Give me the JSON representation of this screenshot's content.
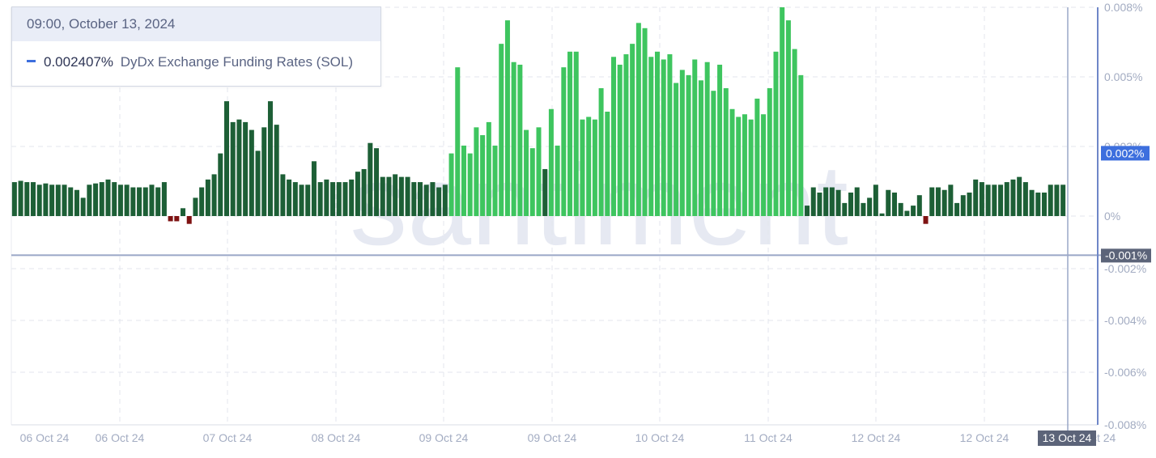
{
  "tooltip": {
    "datetime": "09:00, October 13, 2024",
    "value": "0.002407%",
    "series_name": "DyDx Exchange Funding Rates (SOL)"
  },
  "watermark": "santiment",
  "colors": {
    "dark_green": "#1d5f36",
    "light_green": "#3ec55f",
    "negative": "#7e1212",
    "crosshair": "#9aa7c7",
    "current_badge": "#3d6fde",
    "hover_badge": "#5c6479"
  },
  "chart_data": {
    "type": "bar",
    "series": [
      {
        "name": "DyDx Exchange Funding Rates (SOL)",
        "unit": "%"
      }
    ],
    "ylim": [
      -0.008,
      0.008
    ],
    "y_ticks": [
      "0.008%",
      "0.005%",
      "0.003%",
      "0%",
      "-0.002%",
      "-0.004%",
      "-0.006%",
      "-0.008%"
    ],
    "x_ticks": [
      "06 Oct 24",
      "06 Oct 24",
      "07 Oct 24",
      "08 Oct 24",
      "09 Oct 24",
      "09 Oct 24",
      "10 Oct 24",
      "11 Oct 24",
      "12 Oct 24",
      "12 Oct 24",
      "13 Oct 24"
    ],
    "current_value_label": "0.002%",
    "current_value": 0.002407,
    "hover_value_label": "-0.001%",
    "hover_value": -0.0015,
    "hover_date_label": "13 Oct 24",
    "grid": true,
    "values": [
      0.0013,
      0.00135,
      0.0013,
      0.0013,
      0.0012,
      0.00125,
      0.0012,
      0.0012,
      0.0012,
      0.0011,
      0.001,
      0.0007,
      0.0012,
      0.00125,
      0.0013,
      0.0014,
      0.0013,
      0.0012,
      0.0012,
      0.0011,
      0.0011,
      0.0011,
      0.0012,
      0.0011,
      0.0013,
      -0.0002,
      -0.0002,
      0.0003,
      -0.0003,
      0.0007,
      0.0011,
      0.0014,
      0.0016,
      0.0024,
      0.0044,
      0.0036,
      0.0037,
      0.0036,
      0.0033,
      0.0025,
      0.0034,
      0.0044,
      0.0035,
      0.0016,
      0.0014,
      0.0013,
      0.0012,
      0.0012,
      0.0021,
      0.0013,
      0.0014,
      0.0013,
      0.0013,
      0.0013,
      0.0014,
      0.0017,
      0.0018,
      0.0028,
      0.0026,
      0.0015,
      0.0015,
      0.0016,
      0.0015,
      0.0015,
      0.0013,
      0.0013,
      0.0012,
      0.0013,
      0.0011,
      0.0012,
      0.0024,
      0.0057,
      0.0027,
      0.0024,
      0.0034,
      0.0031,
      0.0036,
      0.0027,
      0.0066,
      0.0075,
      0.0059,
      0.0058,
      0.0033,
      0.0026,
      0.0034,
      0.0018,
      0.0041,
      0.0027,
      0.0057,
      0.0063,
      0.0063,
      0.0037,
      0.0038,
      0.0037,
      0.0049,
      0.004,
      0.0061,
      0.0058,
      0.0062,
      0.0066,
      0.0074,
      0.0072,
      0.0061,
      0.0063,
      0.006,
      0.0062,
      0.0051,
      0.0056,
      0.0054,
      0.006,
      0.0052,
      0.0059,
      0.0048,
      0.0058,
      0.0049,
      0.0041,
      0.0038,
      0.0039,
      0.0037,
      0.0045,
      0.0039,
      0.0049,
      0.0063,
      0.008,
      0.0075,
      0.0064,
      0.0054,
      0.0004,
      0.0011,
      0.0009,
      0.0011,
      0.0011,
      0.001,
      0.0005,
      0.0009,
      0.0011,
      0.0005,
      0.0007,
      0.0012,
      0.0001,
      0.001,
      0.0009,
      0.0005,
      0.0002,
      0.0004,
      0.0008,
      -0.0003,
      0.0011,
      0.0011,
      0.001,
      0.0012,
      0.0005,
      0.0008,
      0.0009,
      0.0014,
      0.0013,
      0.0012,
      0.0012,
      0.0012,
      0.0013,
      0.0014,
      0.0015,
      0.0013,
      0.001,
      0.0009,
      0.0009,
      0.0012,
      0.0012,
      0.0012
    ]
  }
}
